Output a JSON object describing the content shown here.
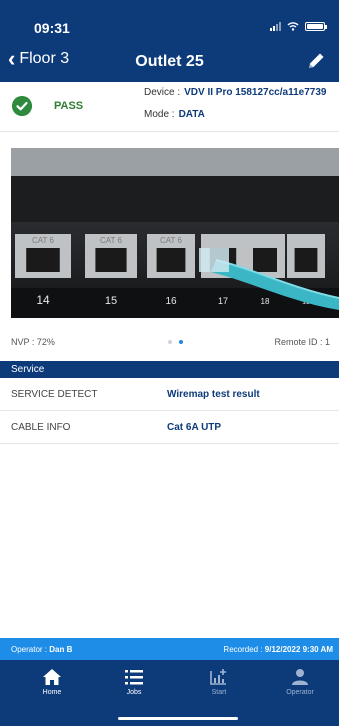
{
  "status": {
    "time": "09:31"
  },
  "nav": {
    "back_label": "Floor 3",
    "title": "Outlet 25"
  },
  "result": {
    "status": "PASS",
    "device_label": "Device :",
    "device_value": "VDV II Pro 158127cc/a11e7739",
    "mode_label": "Mode :",
    "mode_value": "DATA"
  },
  "photo": {
    "port_numbers": [
      "14",
      "15",
      "16",
      "17",
      "18",
      "19"
    ],
    "port_tags": [
      "CAT 6",
      "CAT 6",
      "CAT 6",
      "",
      "",
      ""
    ]
  },
  "info": {
    "nvp": "NVP : 72%",
    "remote_id": "Remote ID : 1",
    "page_count": 2,
    "active_page": 2
  },
  "service": {
    "header": "Service",
    "rows": [
      {
        "key": "SERVICE DETECT",
        "value": "Wiremap test result"
      },
      {
        "key": "CABLE INFO",
        "value": "Cat 6A UTP"
      }
    ]
  },
  "footer": {
    "operator_label": "Operator :",
    "operator_value": "Dan B",
    "recorded_label": "Recorded :",
    "recorded_value": "9/12/2022 9:30 AM"
  },
  "tabs": [
    {
      "label": "Home",
      "icon": "home-icon",
      "active": true
    },
    {
      "label": "Jobs",
      "icon": "list-icon",
      "active": true
    },
    {
      "label": "Start",
      "icon": "chart-add-icon",
      "active": false
    },
    {
      "label": "Operator",
      "icon": "person-icon",
      "active": false
    }
  ],
  "colors": {
    "navy": "#0d3b7a",
    "accent_blue": "#1e8de8",
    "pass_green": "#2e8b3e"
  }
}
